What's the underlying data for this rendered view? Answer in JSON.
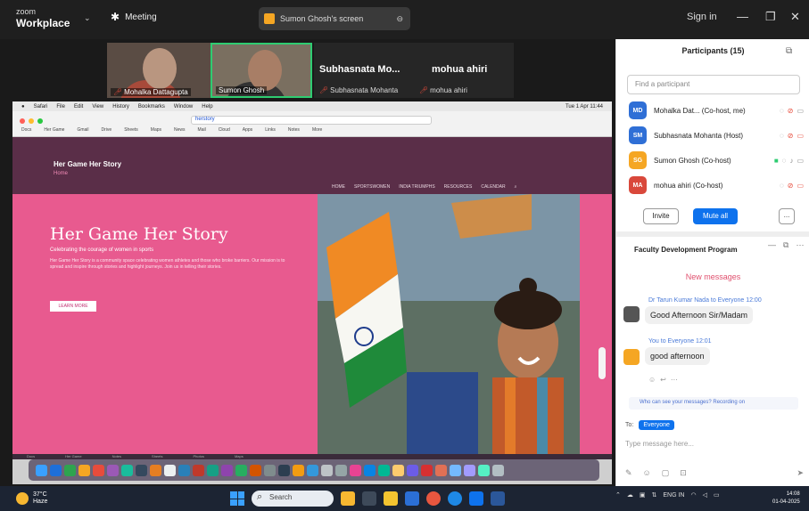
{
  "zoom": {
    "brand_small": "zoom",
    "brand": "Workplace",
    "meeting_label": "Meeting",
    "share_pill": "Sumon Ghosh's screen",
    "signin": "Sign in",
    "colors": {
      "bar": "#1f1f1f",
      "accent_blue": "#0e72ed",
      "active_speaker": "#2ecc71"
    }
  },
  "videos": [
    {
      "name": "Mohalka Dattagupta"
    },
    {
      "name": "Sumon Ghosh"
    }
  ],
  "name_tiles": [
    {
      "big": "Subhasnata Mo...",
      "small": "Subhasnata Mohanta"
    },
    {
      "big": "mohua ahiri",
      "small": "mohua ahiri"
    }
  ],
  "mac": {
    "menubar": [
      "Safari",
      "File",
      "Edit",
      "View",
      "History",
      "Bookmarks",
      "Window",
      "Help"
    ],
    "clock": "Tue 1 Apr 11:44",
    "url": "herstory",
    "bookmarks": [
      "Docs",
      "Her Game",
      "Gmail",
      "Drive",
      "Sheets",
      "Maps",
      "News",
      "Mail",
      "Cloud",
      "Apps",
      "Links",
      "Notes",
      "More"
    ]
  },
  "site": {
    "title": "Her Game Her Story",
    "tagline": "Home",
    "nav": [
      "HOME",
      "SPORTSWOMEN",
      "INDIA TRIUMPHS",
      "RESOURCES",
      "CALENDAR"
    ],
    "hero_title": "Her Game Her Story",
    "hero_sub": "Celebrating the courage of women in sports",
    "hero_body": "Her Game Her Story is a community space celebrating women athletes and those who broke barriers. Our mission is to spread and inspire through stories and highlight journeys. Join us in telling their stories.",
    "learn_more": "LEARN MORE"
  },
  "dock_labels": [
    "Docs",
    "Her Game",
    "Notes",
    "Sheets",
    "Photos",
    "Maps"
  ],
  "panel": {
    "participants_title": "Participants (15)",
    "search_placeholder": "Find a participant",
    "participants": [
      {
        "initials": "MD",
        "name": "Mohalka Dat... (Co-host, me)",
        "color": "#2f6fd6"
      },
      {
        "initials": "SM",
        "name": "Subhasnata Mohanta (Host)",
        "color": "#2f6fd6"
      },
      {
        "initials": "SG",
        "name": "Sumon Ghosh (Co-host)",
        "color": "#f5a623"
      },
      {
        "initials": "MA",
        "name": "mohua ahiri (Co-host)",
        "color": "#d9483b"
      }
    ],
    "invite": "Invite",
    "mute_all": "Mute all",
    "more": "...",
    "chat_title": "Faculty Development Program",
    "new_messages": "New messages",
    "messages": [
      {
        "meta": "Dr Tarun Kumar Nada to Everyone 12:00",
        "text": "Good Afternoon Sir/Madam"
      },
      {
        "meta": "You to Everyone 12:01",
        "text": "good afternoon"
      }
    ],
    "who_can_see": "Who can see your messages? Recording on",
    "to_label": "To:",
    "to_value": "Everyone",
    "type_placeholder": "Type message here..."
  },
  "taskbar": {
    "temp": "37°C",
    "weather": "Haze",
    "search": "Search",
    "lang": "ENG IN",
    "time": "14:08",
    "date": "01-04-2025"
  }
}
